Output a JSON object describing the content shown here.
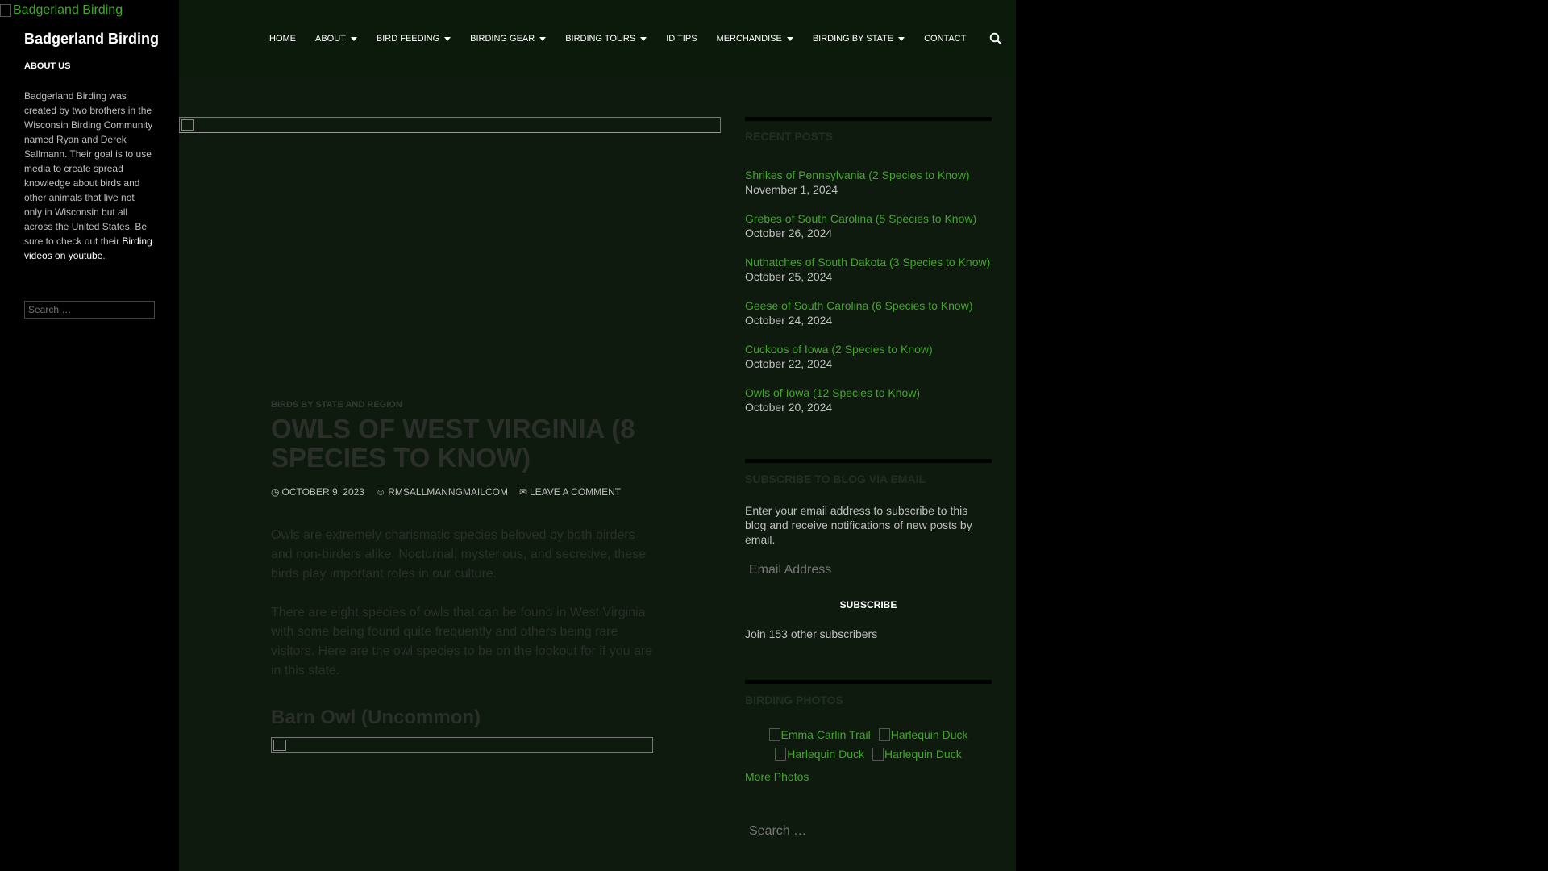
{
  "site": {
    "logo_alt": "Badgerland Birding",
    "title": "Badgerland Birding"
  },
  "about": {
    "heading": "ABOUT US",
    "text": "Badgerland Birding was created by two brothers in the Wisconsin Birding Community named Ryan and Derek Sallmann. Their goal is to use media to create spread knowledge about birds and other animals that live not only in Wisconsin but all across the United States. Be sure to check out their",
    "link": "Birding videos on youtube",
    "trailing": "."
  },
  "left_search": {
    "placeholder": "Search …"
  },
  "nav": {
    "items": [
      {
        "label": "HOME",
        "dropdown": false
      },
      {
        "label": "ABOUT",
        "dropdown": true
      },
      {
        "label": "BIRD FEEDING",
        "dropdown": true
      },
      {
        "label": "BIRDING GEAR",
        "dropdown": true
      },
      {
        "label": "BIRDING TOURS",
        "dropdown": true
      },
      {
        "label": "ID TIPS",
        "dropdown": false
      },
      {
        "label": "MERCHANDISE",
        "dropdown": true
      },
      {
        "label": "BIRDING BY STATE",
        "dropdown": true
      },
      {
        "label": "CONTACT",
        "dropdown": false
      }
    ],
    "search_icon": "search-icon"
  },
  "post": {
    "category": "BIRDS BY STATE AND REGION",
    "title": "OWLS OF WEST VIRGINIA (8 SPECIES TO KNOW)",
    "date": "OCTOBER 9, 2023",
    "author": "RMSALLMANNGMAILCOM",
    "comment": "LEAVE A COMMENT",
    "paragraphs": [
      "Owls are extremely charismatic species beloved by both birders and non-birders alike. Nocturnal, mysterious, and secretive, these birds play important roles in our culture.",
      "There are eight species of owls that can be found in West Virginia with some being found quite frequently and others being rare visitors. Here are the owl species to be on the lookout for if you are in this state."
    ],
    "subheading": "Barn Owl (Uncommon)"
  },
  "recent_posts": {
    "heading": "RECENT POSTS",
    "items": [
      {
        "title": "Shrikes of Pennsylvania (2 Species to Know)",
        "date": "November 1, 2024"
      },
      {
        "title": "Grebes of South Carolina (5 Species to Know)",
        "date": "October 26, 2024"
      },
      {
        "title": "Nuthatches of South Dakota (3 Species to Know)",
        "date": "October 25, 2024"
      },
      {
        "title": "Geese of South Carolina (6 Species to Know)",
        "date": "October 24, 2024"
      },
      {
        "title": "Cuckoos of Iowa (2 Species to Know)",
        "date": "October 22, 2024"
      },
      {
        "title": "Owls of Iowa (12 Species to Know)",
        "date": "October 20, 2024"
      }
    ]
  },
  "subscribe": {
    "heading": "SUBSCRIBE TO BLOG VIA EMAIL",
    "text": "Enter your email address to subscribe to this blog and receive notifications of new posts by email.",
    "email_placeholder": "Email Address",
    "button": "SUBSCRIBE",
    "count_text": "Join 153 other subscribers"
  },
  "photos": {
    "heading": "BIRDING PHOTOS",
    "row1": [
      "Emma Carlin Trail",
      "Harlequin Duck"
    ],
    "row2": [
      "Harlequin Duck",
      "Harlequin Duck"
    ],
    "more": "More Photos"
  },
  "right_search": {
    "placeholder": "Search …"
  },
  "colors": {
    "link_green": "#41a62a",
    "panel": "#0e1a0e",
    "background": "#000000"
  }
}
